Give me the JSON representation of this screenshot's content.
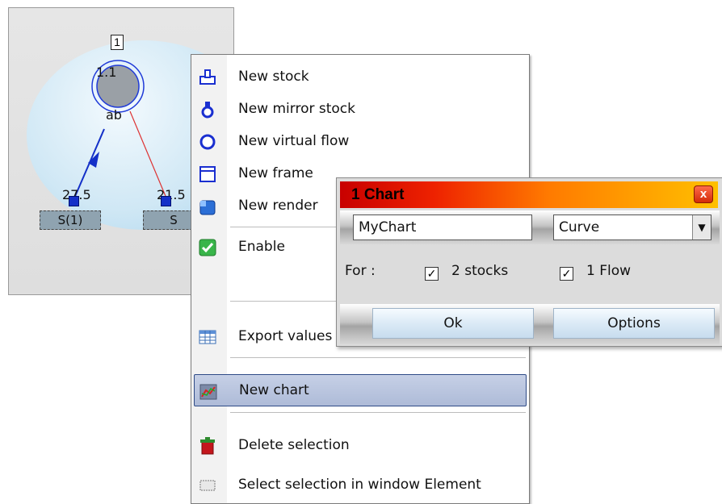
{
  "diagram": {
    "frame_number": "1",
    "stock_value": "1.1",
    "flow_label": "ab",
    "left_value": "27.5",
    "right_value": "21.5",
    "left_stock": "S(1)",
    "right_stock": "S"
  },
  "menu": {
    "items": [
      {
        "label": "New stock",
        "icon": "new-stock-icon"
      },
      {
        "label": "New mirror stock",
        "icon": "mirror-stock-icon"
      },
      {
        "label": "New virtual flow",
        "icon": "virtual-flow-icon"
      },
      {
        "label": "New frame",
        "icon": "frame-icon"
      },
      {
        "label": "New render",
        "icon": "render-icon"
      },
      {
        "label": "Enable",
        "icon": "enable-check-icon"
      },
      {
        "label": "Export values",
        "icon": "table-icon"
      },
      {
        "label": "New chart",
        "icon": "chart-icon"
      },
      {
        "label": "Delete selection",
        "icon": "trash-icon"
      },
      {
        "label": "Select selection in window Element",
        "icon": "selection-icon"
      }
    ]
  },
  "dialog": {
    "title": "1  Chart",
    "close_symbol": "x",
    "name_value": "MyChart",
    "type_value": "Curve",
    "for_label": "For :",
    "stocks_label": "2 stocks",
    "flow_label": "1 Flow",
    "stocks_checked": true,
    "flow_checked": true,
    "ok_label": "Ok",
    "options_label": "Options"
  },
  "colors": {
    "highlight": "#aebbd8",
    "title_start": "#c80000",
    "title_end": "#ffc000",
    "node": "#1430c8",
    "flow_line": "#d33"
  }
}
